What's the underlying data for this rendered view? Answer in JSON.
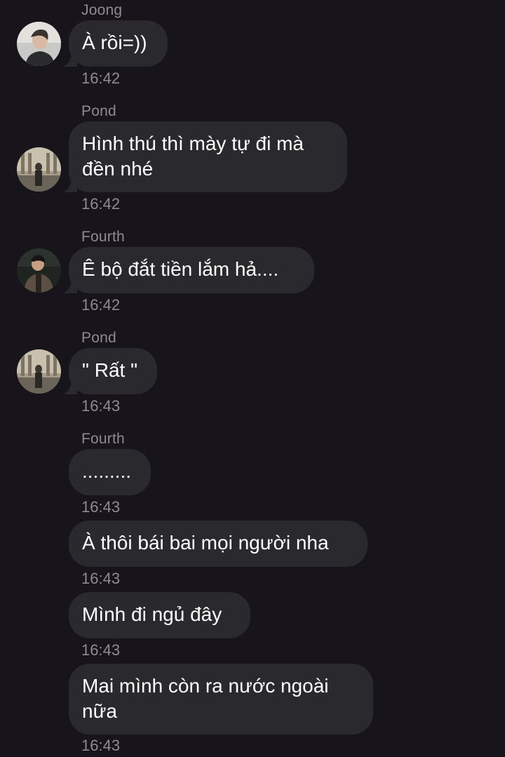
{
  "messages": [
    {
      "sender": "Joong",
      "text_lines": [
        "À rồi=))"
      ],
      "time": "16:42",
      "avatar": "joong-avatar"
    },
    {
      "sender": "Pond",
      "text_lines": [
        "Hình thú thì mày tự đi mà",
        "đền nhé"
      ],
      "time": "16:42",
      "avatar": "pond-avatar"
    },
    {
      "sender": "Fourth",
      "text_lines": [
        "Ê bộ đắt tiền lắm hả...."
      ],
      "time": "16:42",
      "avatar": "fourth-avatar"
    },
    {
      "sender": "Pond",
      "text_lines": [
        "\" Rất \""
      ],
      "time": "16:43",
      "avatar": "pond-avatar"
    },
    {
      "sender": "Fourth",
      "text_lines": [
        "........."
      ],
      "time": "16:43"
    },
    {
      "text_lines": [
        "À thôi bái bai mọi người nha"
      ],
      "time": "16:43"
    },
    {
      "text_lines": [
        "Mình đi ngủ đây"
      ],
      "time": "16:43"
    },
    {
      "text_lines": [
        "Mai mình còn ra nước ngoài",
        "nữa"
      ],
      "time": "16:43"
    }
  ],
  "colors": {
    "background": "#17151b",
    "bubble": "#2a292e",
    "meta_text": "#8d8b91",
    "message_text": "#ffffff"
  }
}
